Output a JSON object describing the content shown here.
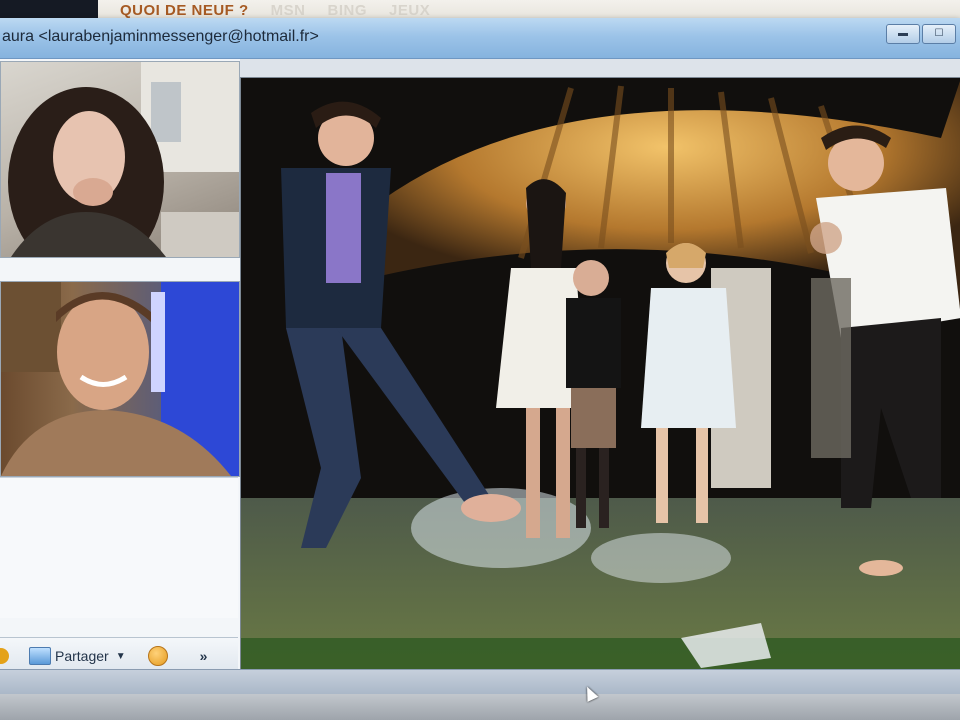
{
  "topnav": {
    "links": [
      "QUOI DE NEUF ?",
      "MSN",
      "BING",
      "JEUX"
    ]
  },
  "window": {
    "title": "aura <laurabenjaminmessenger@hotmail.fr>"
  },
  "toolbar": {
    "share_label": "Partager",
    "more_label": "»"
  },
  "icons": {
    "status": "status-dot-icon",
    "share": "share-photo-icon",
    "emoticon": "emoticon-icon",
    "minimize": "minimize-icon",
    "maximize": "maximize-icon"
  }
}
